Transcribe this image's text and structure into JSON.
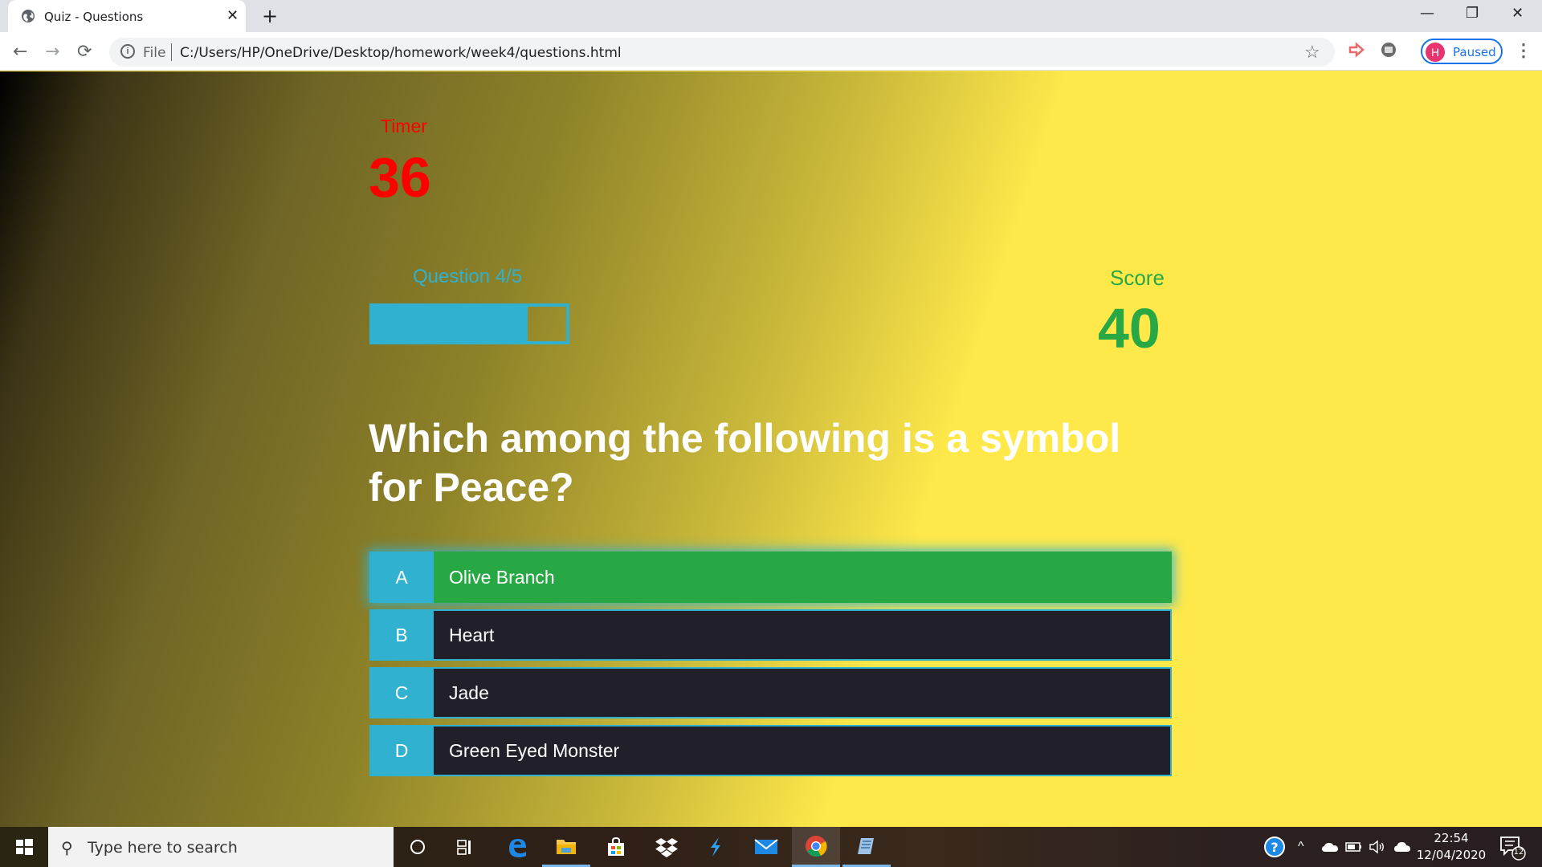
{
  "browser": {
    "tab_title": "Quiz - Questions",
    "new_tab_label": "+",
    "file_label": "File",
    "url": "C:/Users/HP/OneDrive/Desktop/homework/week4/questions.html",
    "profile_initial": "H",
    "profile_status": "Paused"
  },
  "quiz": {
    "timer_label": "Timer",
    "timer_value": "36",
    "question_counter": "Question 4/5",
    "progress_fraction": 0.8,
    "score_label": "Score",
    "score_value": "40",
    "question_text": "Which among the following is a symbol for Peace?",
    "answers": [
      {
        "prefix": "A",
        "text": "Olive Branch",
        "state": "correct"
      },
      {
        "prefix": "B",
        "text": "Heart",
        "state": "default"
      },
      {
        "prefix": "C",
        "text": "Jade",
        "state": "default"
      },
      {
        "prefix": "D",
        "text": "Green Eyed Monster",
        "state": "default"
      }
    ]
  },
  "taskbar": {
    "search_placeholder": "Type here to search",
    "time": "22:54",
    "date": "12/04/2020",
    "notification_count": "12"
  },
  "colors": {
    "accent": "#2fb1cf",
    "timer": "#ff0000",
    "score": "#28a745",
    "correct": "#28a745",
    "answer_bg": "#211f2a",
    "page_bg": "#ffe94a"
  }
}
